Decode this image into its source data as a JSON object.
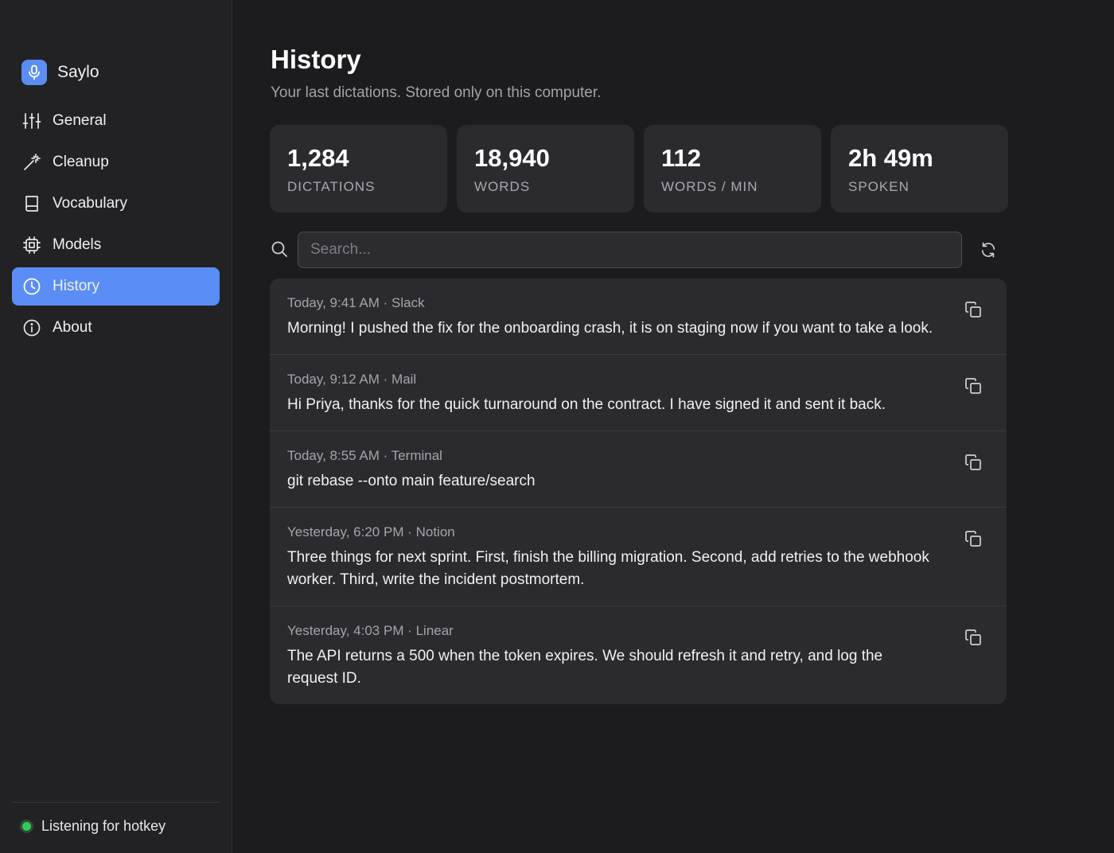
{
  "app": {
    "name": "Saylo"
  },
  "sidebar": {
    "items": [
      {
        "label": "General",
        "icon": "sliders-icon",
        "active": false
      },
      {
        "label": "Cleanup",
        "icon": "magic-wand-icon",
        "active": false
      },
      {
        "label": "Vocabulary",
        "icon": "book-icon",
        "active": false
      },
      {
        "label": "Models",
        "icon": "chip-icon",
        "active": false
      },
      {
        "label": "History",
        "icon": "clock-icon",
        "active": true
      },
      {
        "label": "About",
        "icon": "info-icon",
        "active": false
      }
    ],
    "status": {
      "label": "Listening for hotkey",
      "color": "#34c759"
    }
  },
  "page": {
    "title": "History",
    "subtitle": "Your last dictations. Stored only on this computer."
  },
  "stats": [
    {
      "value": "1,284",
      "label": "DICTATIONS"
    },
    {
      "value": "18,940",
      "label": "WORDS"
    },
    {
      "value": "112",
      "label": "WORDS / MIN"
    },
    {
      "value": "2h 49m",
      "label": "SPOKEN"
    }
  ],
  "search": {
    "placeholder": "Search...",
    "value": ""
  },
  "history": [
    {
      "meta": "Today, 9:41 AM · Slack",
      "text": "Morning! I pushed the fix for the onboarding crash, it is on staging now if you want to take a look."
    },
    {
      "meta": "Today, 9:12 AM · Mail",
      "text": "Hi Priya, thanks for the quick turnaround on the contract. I have signed it and sent it back."
    },
    {
      "meta": "Today, 8:55 AM · Terminal",
      "text": "git rebase --onto main feature/search"
    },
    {
      "meta": "Yesterday, 6:20 PM · Notion",
      "text": "Three things for next sprint. First, finish the billing migration. Second, add retries to the webhook worker. Third, write the incident postmortem."
    },
    {
      "meta": "Yesterday, 4:03 PM · Linear",
      "text": "The API returns a 500 when the token expires. We should refresh it and retry, and log the request ID."
    }
  ],
  "colors": {
    "accent": "#5a8df5",
    "background": "#1c1c1e",
    "sidebar": "#222225",
    "card": "#2b2b2f"
  }
}
